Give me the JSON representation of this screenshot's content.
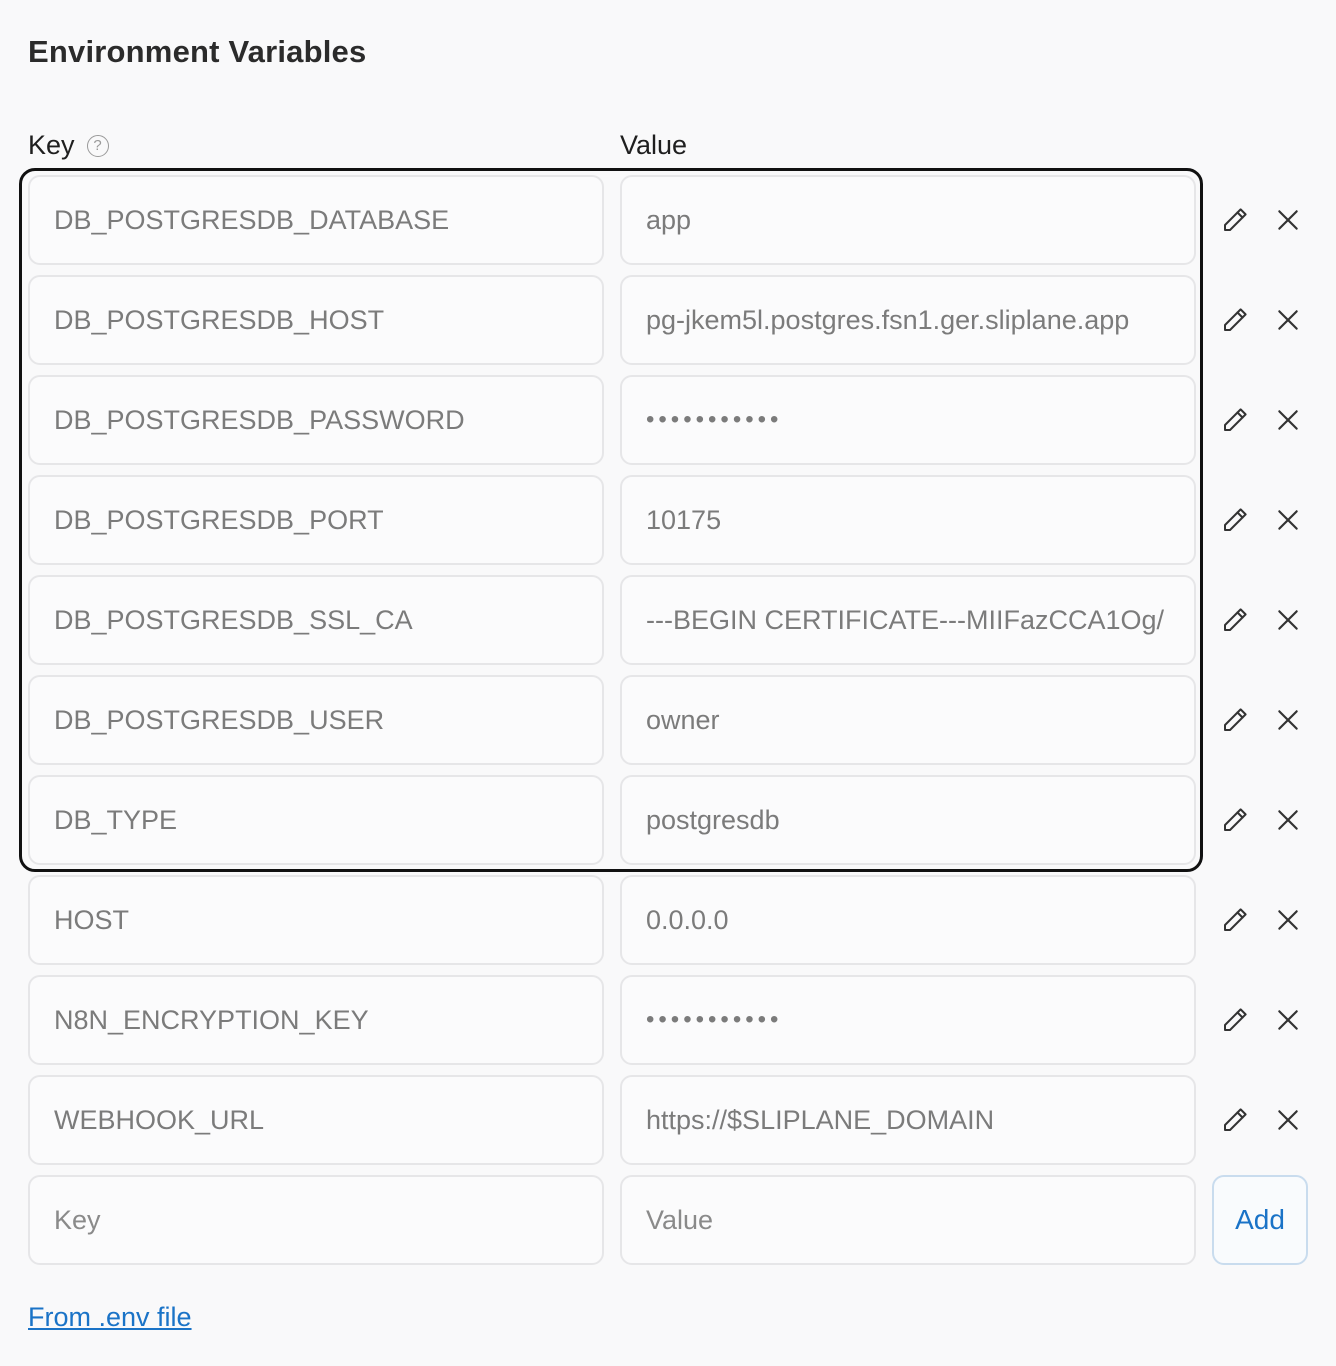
{
  "section": {
    "title": "Environment Variables",
    "key_header": "Key",
    "value_header": "Value",
    "help_icon": "question-circle-icon"
  },
  "variables": [
    {
      "key": "DB_POSTGRESDB_DATABASE",
      "value": "app",
      "masked": false
    },
    {
      "key": "DB_POSTGRESDB_HOST",
      "value": "pg-jkem5l.postgres.fsn1.ger.sliplane.app",
      "masked": false
    },
    {
      "key": "DB_POSTGRESDB_PASSWORD",
      "value": "•••••••••••",
      "masked": true
    },
    {
      "key": "DB_POSTGRESDB_PORT",
      "value": "10175",
      "masked": false
    },
    {
      "key": "DB_POSTGRESDB_SSL_CA",
      "value": "---BEGIN CERTIFICATE---MIIFazCCA1Og/",
      "masked": false
    },
    {
      "key": "DB_POSTGRESDB_USER",
      "value": "owner",
      "masked": false
    },
    {
      "key": "DB_TYPE",
      "value": "postgresdb",
      "masked": false
    },
    {
      "key": "HOST",
      "value": "0.0.0.0",
      "masked": false
    },
    {
      "key": "N8N_ENCRYPTION_KEY",
      "value": "•••••••••••",
      "masked": true
    },
    {
      "key": "WEBHOOK_URL",
      "value": "https://$SLIPLANE_DOMAIN",
      "masked": false
    }
  ],
  "row_icons": {
    "edit": "pencil-icon",
    "delete": "close-icon"
  },
  "new_entry": {
    "key_placeholder": "Key",
    "value_placeholder": "Value",
    "add_label": "Add"
  },
  "footer": {
    "env_file_link": "From .env file"
  },
  "colors": {
    "accent": "#1a73c7",
    "field_border": "#e6e6e8",
    "highlight_border": "#111111"
  }
}
